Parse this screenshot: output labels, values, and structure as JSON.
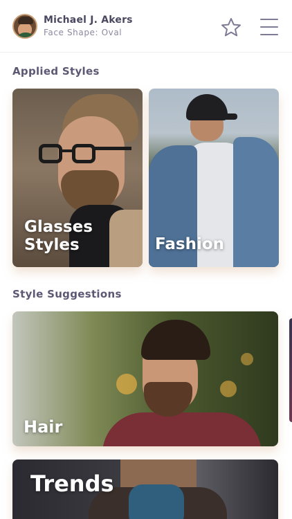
{
  "header": {
    "user_name": "Michael J. Akers",
    "face_shape_text": "Face Shape: Oval"
  },
  "sections": {
    "applied_styles_title": "Applied Styles",
    "style_suggestions_title": "Style Suggestions"
  },
  "applied_styles": [
    {
      "label_line1": "Glasses",
      "label_line2": "Styles"
    },
    {
      "label": "Fashion"
    }
  ],
  "suggestions": [
    {
      "label": "Hair"
    },
    {
      "label": "Trends"
    }
  ],
  "icons": {
    "favorite": "star-outline-icon",
    "menu": "hamburger-menu-icon"
  },
  "colors": {
    "heading_text": "#5c5874",
    "icon_color": "#7d7a96",
    "card_shadow": "#d6ae8c"
  }
}
